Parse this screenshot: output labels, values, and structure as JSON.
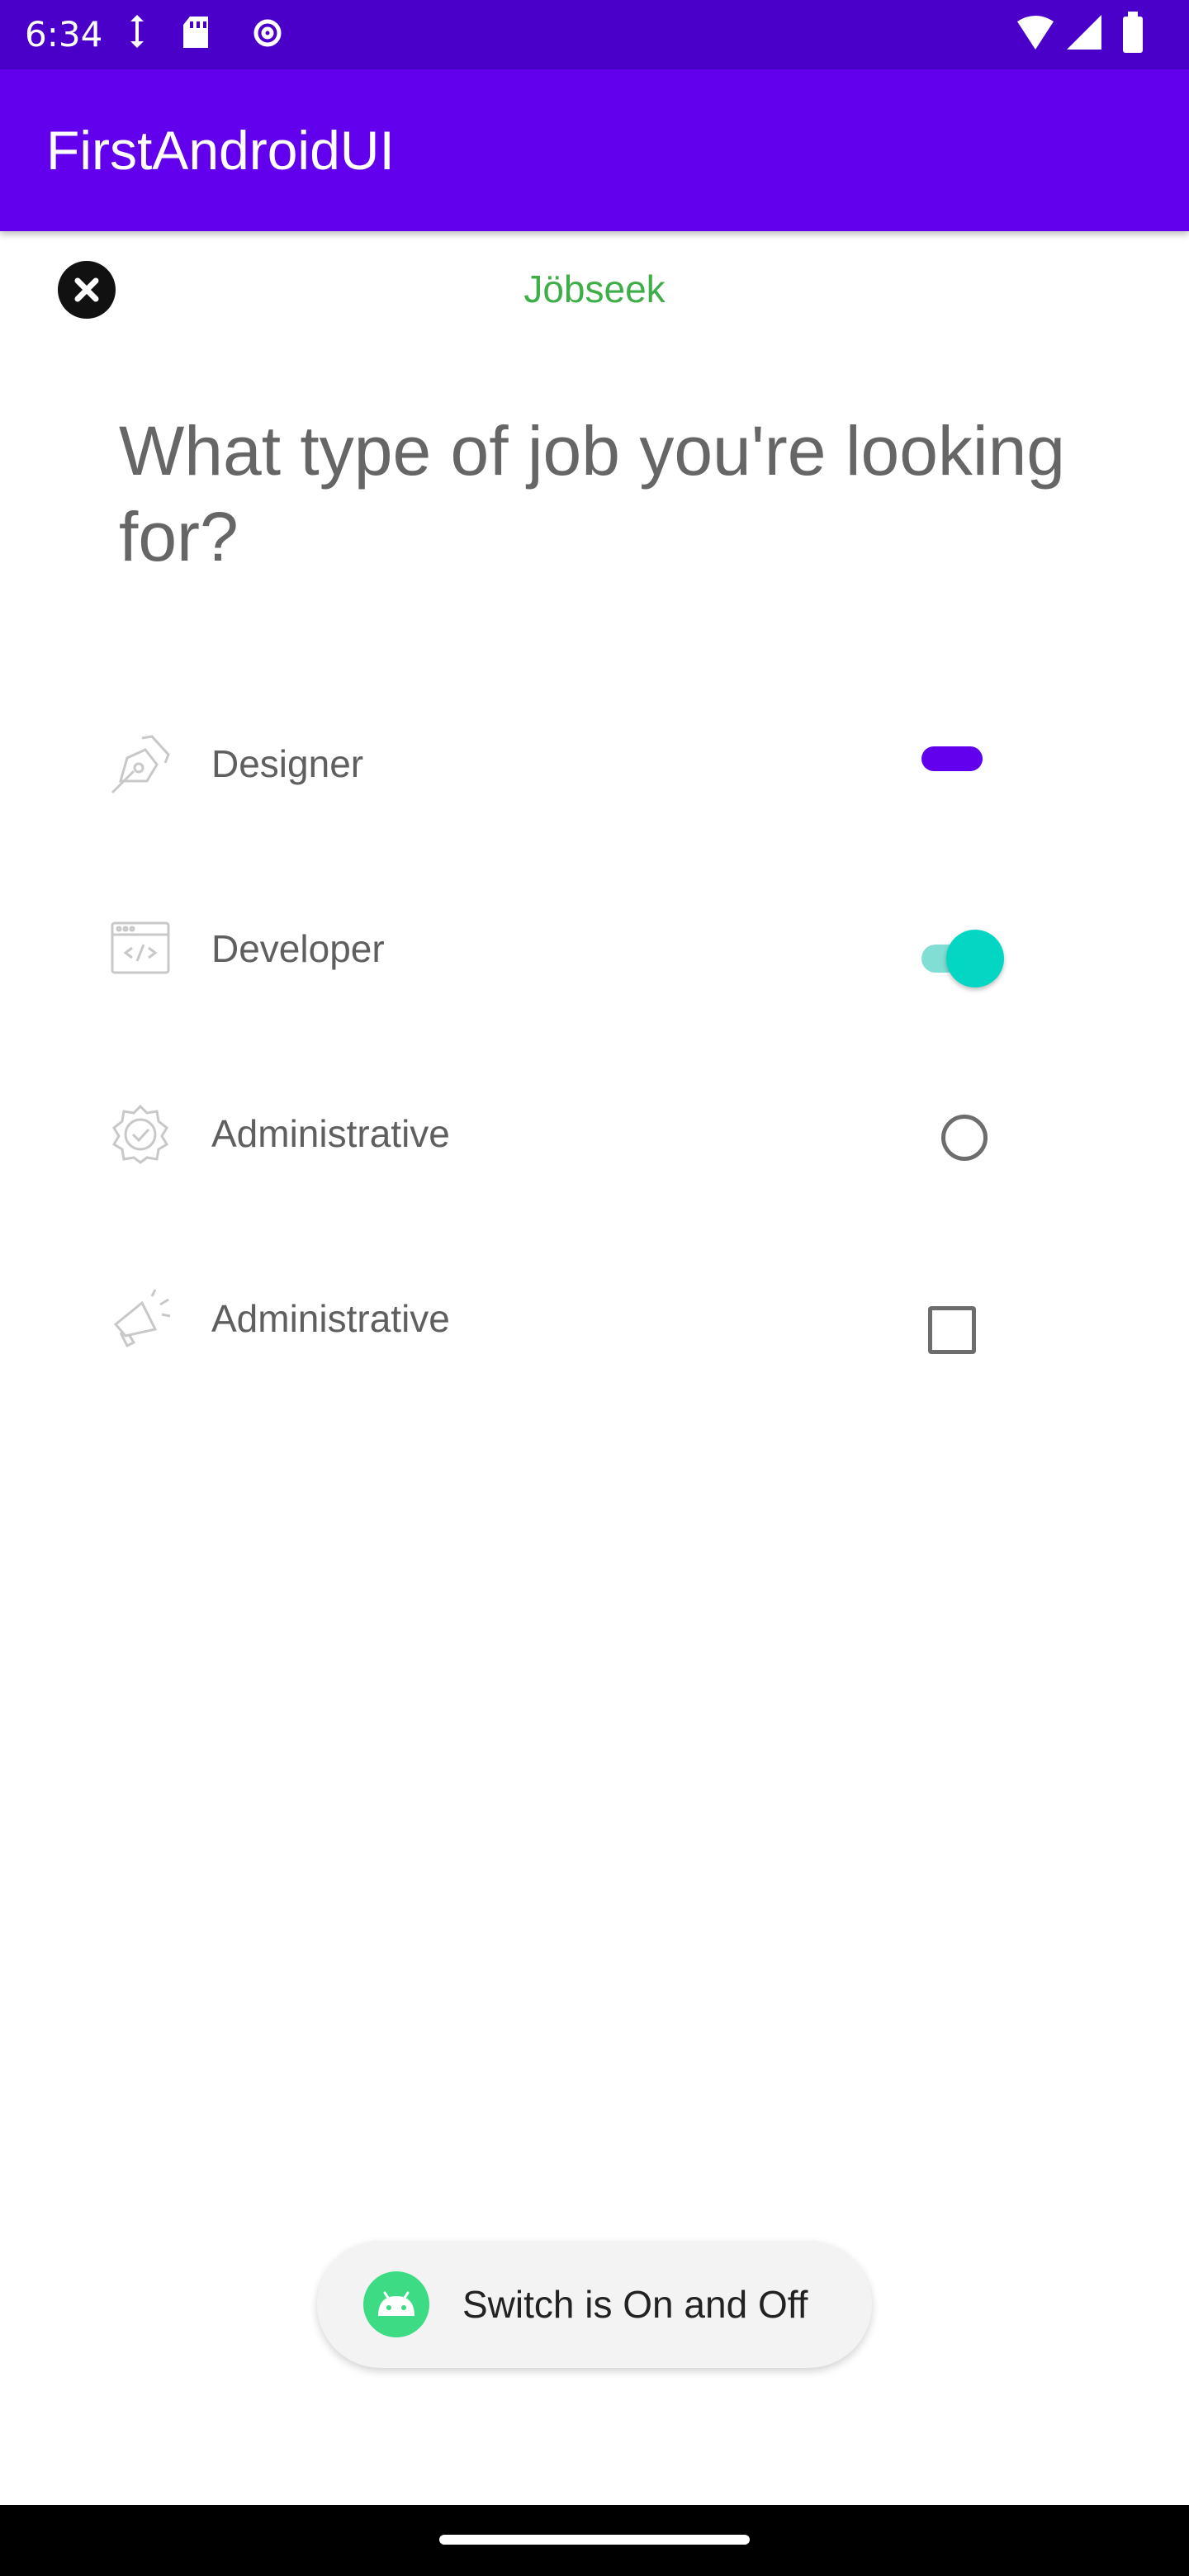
{
  "status_bar": {
    "time": "6:34",
    "left_icons": [
      "data-transfer-icon",
      "sd-card-icon",
      "settings-gear-icon"
    ],
    "right_icons": [
      "wifi-icon",
      "cell-signal-icon",
      "battery-icon"
    ]
  },
  "app_bar": {
    "title": "FirstAndroidUI",
    "color": "#6200ee"
  },
  "screen": {
    "close_icon": "close-icon",
    "brand": "Jöbseek",
    "question": "What type of job you're looking for?"
  },
  "options": [
    {
      "label": "Designer",
      "icon": "pen-tool-icon",
      "control": "switch",
      "checked": false
    },
    {
      "label": "Developer",
      "icon": "code-window-icon",
      "control": "switch",
      "checked": true
    },
    {
      "label": "Administrative",
      "icon": "gear-check-icon",
      "control": "radio",
      "checked": false
    },
    {
      "label": "Administrative",
      "icon": "megaphone-icon",
      "control": "checkbox",
      "checked": false
    }
  ],
  "toast": {
    "text": "Switch is On and Off",
    "icon": "android-icon"
  },
  "colors": {
    "accent_teal": "#03d6c2",
    "brand_green": "#3fae49",
    "status_bar": "#4a00c8"
  }
}
